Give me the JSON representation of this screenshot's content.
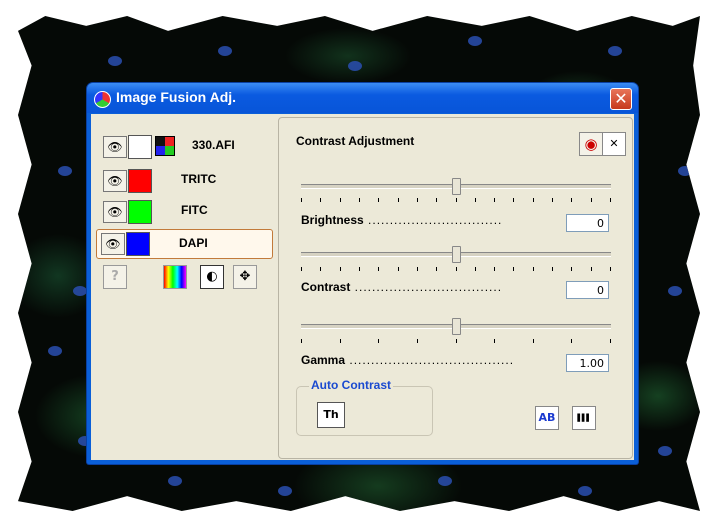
{
  "window": {
    "title": "Image Fusion Adj.",
    "close_glyph": "✕"
  },
  "channels": [
    {
      "label": "330.AFI",
      "color": "#ffffff",
      "eye": "👁",
      "composite": true
    },
    {
      "label": "TRITC",
      "color": "#ff0000",
      "eye": "👁"
    },
    {
      "label": "FITC",
      "color": "#00ff00",
      "eye": "👁"
    },
    {
      "label": "DAPI",
      "color": "#0000ff",
      "eye": "👁",
      "selected": true
    }
  ],
  "tools": {
    "help_glyph": "?",
    "palette_glyph": "▮",
    "contrast_glyph": "◐",
    "move_glyph": "✥"
  },
  "panel": {
    "heading": "Contrast Adjustment",
    "target_glyph": "◉",
    "close_glyph": "✕",
    "brightness": {
      "label": "Brightness",
      "value": "0",
      "slider_fraction": 0.5
    },
    "contrast": {
      "label": "Contrast",
      "value": "0",
      "slider_fraction": 0.5
    },
    "gamma": {
      "label": "Gamma",
      "value": "1.00",
      "slider_fraction": 0.5
    },
    "auto_contrast": {
      "label": "Auto Contrast",
      "button": "Th"
    },
    "ab_button": "AB",
    "histogram_glyph": "▌▌▌"
  }
}
